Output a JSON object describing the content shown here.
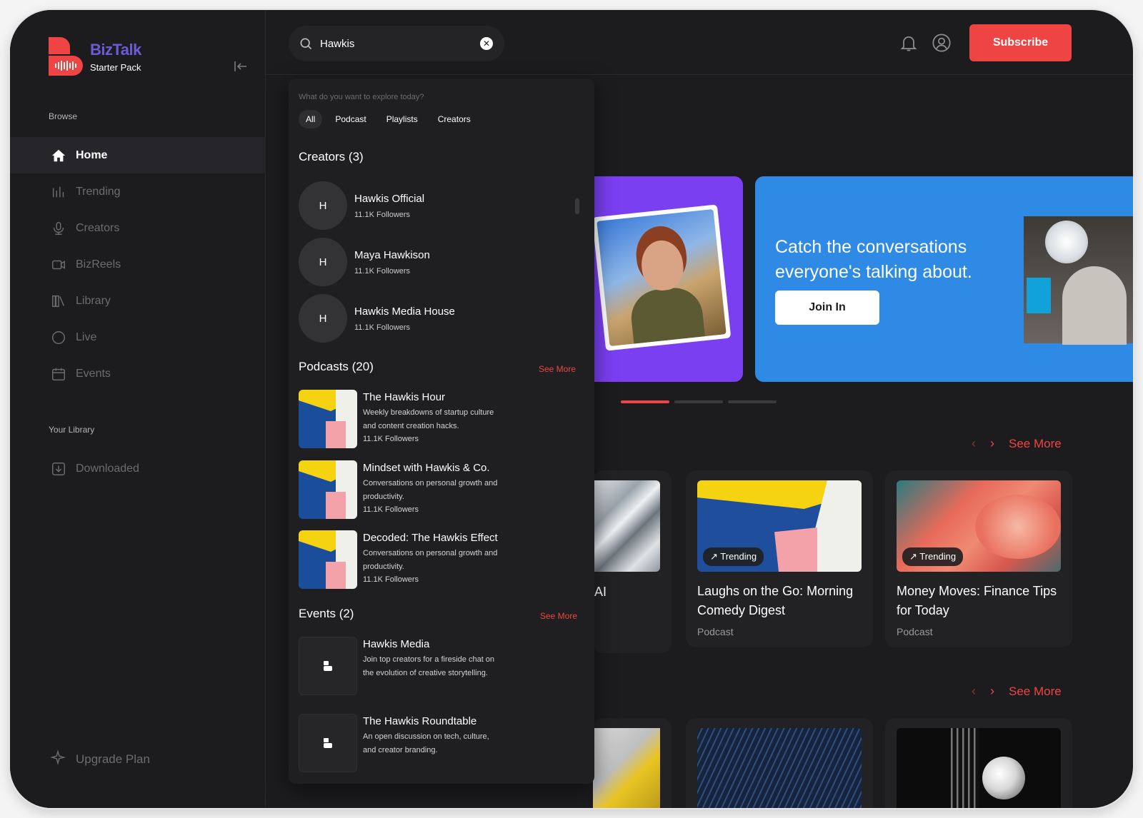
{
  "brand": {
    "title": "BizTalk",
    "subtitle": "Starter Pack",
    "accent": "#ef4444",
    "logo_color": "#6b5bd6"
  },
  "sidebar": {
    "browse_label": "Browse",
    "items": [
      {
        "label": "Home",
        "icon": "home-icon",
        "active": true
      },
      {
        "label": "Trending",
        "icon": "bar-chart-icon"
      },
      {
        "label": "Creators",
        "icon": "microphone-icon"
      },
      {
        "label": "BizReels",
        "icon": "video-icon"
      },
      {
        "label": "Library",
        "icon": "library-icon"
      },
      {
        "label": "Live",
        "icon": "live-icon"
      },
      {
        "label": "Events",
        "icon": "calendar-icon"
      }
    ],
    "library_label": "Your Library",
    "library_items": [
      {
        "label": "Downloaded",
        "icon": "download-icon"
      }
    ],
    "upgrade_label": "Upgrade Plan"
  },
  "header": {
    "search_value": "Hawkis",
    "subscribe_label": "Subscribe"
  },
  "dropdown": {
    "prompt": "What do you want to explore today?",
    "tabs": [
      "All",
      "Podcast",
      "Playlists",
      "Creators"
    ],
    "creators_heading": "Creators (3)",
    "creators": [
      {
        "initial": "H",
        "name": "Hawkis Official",
        "followers": "11.1K Followers"
      },
      {
        "initial": "H",
        "name": "Maya Hawkison",
        "followers": "11.1K Followers"
      },
      {
        "initial": "H",
        "name": "Hawkis Media House",
        "followers": "11.1K Followers"
      }
    ],
    "podcasts_heading": "Podcasts (20)",
    "podcasts_see_more": "See More",
    "podcasts": [
      {
        "name": "The Hawkis Hour",
        "desc": "Weekly breakdowns of startup culture and content creation hacks.",
        "followers": "11.1K Followers"
      },
      {
        "name": "Mindset with Hawkis & Co.",
        "desc": "Conversations on personal growth and productivity.",
        "followers": "11.1K Followers"
      },
      {
        "name": "Decoded: The Hawkis Effect",
        "desc": "Conversations on personal growth and productivity.",
        "followers": "11.1K Followers"
      }
    ],
    "events_heading": "Events (2)",
    "events_see_more": "See More",
    "events": [
      {
        "name": "Hawkis Media",
        "desc": "Join top creators for a fireside chat on the evolution of creative storytelling."
      },
      {
        "name": "The Hawkis Roundtable",
        "desc": "An open discussion on tech, culture, and creator branding."
      }
    ]
  },
  "hero": {
    "title": "Catch the conversations everyone's talking about.",
    "cta": "Join In",
    "slide_count": 3,
    "active_slide": 1
  },
  "row1": {
    "see_more": "See More",
    "partial_title": "AI",
    "cards": [
      {
        "badge": "Trending",
        "title": "Laughs on the Go: Morning Comedy Digest",
        "subtitle": "Podcast"
      },
      {
        "badge": "Trending",
        "title": "Money Moves: Finance Tips for Today",
        "subtitle": "Podcast"
      }
    ]
  },
  "row2": {
    "see_more": "See More"
  }
}
